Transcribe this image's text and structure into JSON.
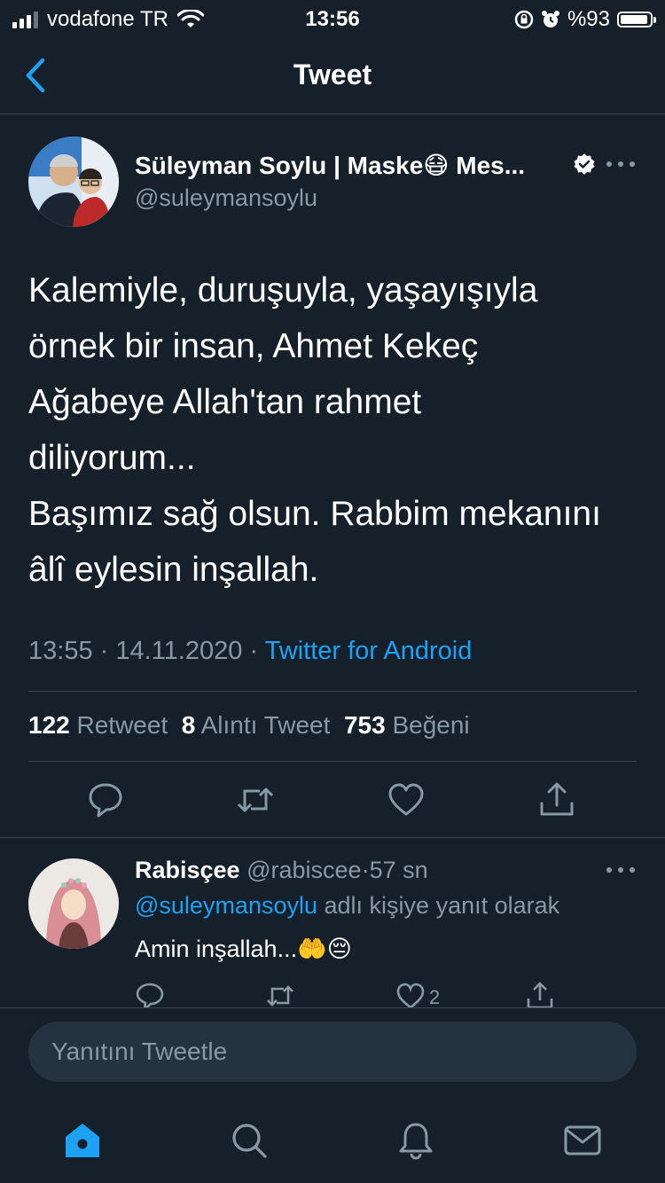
{
  "status_bar": {
    "carrier": "vodafone TR",
    "time": "13:56",
    "battery": "%93",
    "battery_level": 0.93
  },
  "nav": {
    "title": "Tweet"
  },
  "tweet": {
    "author_name": "Süleyman Soylu | Maske😷 Mes...",
    "handle": "@suleymansoylu",
    "text": "Kalemiyle, duruşuyla, yaşayışıyla\nörnek bir insan, Ahmet Kekeç\nAğabeye Allah'tan rahmet\ndiliyorum...\nBaşımız sağ olsun. Rabbim mekanını\nâlî eylesin inşallah.",
    "time": "13:55",
    "date": "14.11.2020",
    "separator": "·",
    "source": "Twitter for Android",
    "stats": {
      "retweet_count": "122",
      "retweet_label": "Retweet",
      "quote_count": "8",
      "quote_label": "Alıntı Tweet",
      "like_count": "753",
      "like_label": "Beğeni"
    }
  },
  "reply": {
    "name": "Rabisçee",
    "handle": "@rabiscee",
    "time": "57 sn",
    "separator": "·",
    "reply_to_handle": "@suleymansoylu",
    "reply_to_suffix": "adlı kişiye yanıt olarak",
    "text": "Amin inşallah...🤲😔",
    "like_count": "2"
  },
  "composer": {
    "placeholder": "Yanıtını Tweetle"
  },
  "colors": {
    "background": "#15202b",
    "accent": "#1da1f2",
    "muted": "#8899a6",
    "divider": "#38444d"
  },
  "icons": {
    "back": "chevron-left-icon",
    "reply": "speech-bubble-icon",
    "retweet": "retweet-icon",
    "like": "heart-icon",
    "share": "share-icon",
    "home": "home-icon",
    "search": "search-icon",
    "notifications": "bell-icon",
    "messages": "mail-icon"
  }
}
